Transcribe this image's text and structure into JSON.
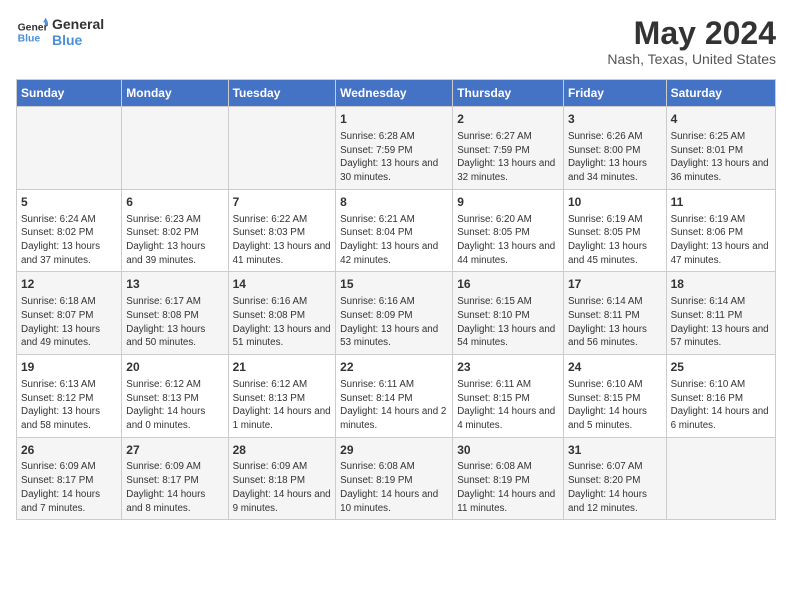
{
  "header": {
    "logo_line1": "General",
    "logo_line2": "Blue",
    "month_year": "May 2024",
    "location": "Nash, Texas, United States"
  },
  "days_of_week": [
    "Sunday",
    "Monday",
    "Tuesday",
    "Wednesday",
    "Thursday",
    "Friday",
    "Saturday"
  ],
  "weeks": [
    [
      {
        "day": "",
        "info": ""
      },
      {
        "day": "",
        "info": ""
      },
      {
        "day": "",
        "info": ""
      },
      {
        "day": "1",
        "info": "Sunrise: 6:28 AM\nSunset: 7:59 PM\nDaylight: 13 hours and 30 minutes."
      },
      {
        "day": "2",
        "info": "Sunrise: 6:27 AM\nSunset: 7:59 PM\nDaylight: 13 hours and 32 minutes."
      },
      {
        "day": "3",
        "info": "Sunrise: 6:26 AM\nSunset: 8:00 PM\nDaylight: 13 hours and 34 minutes."
      },
      {
        "day": "4",
        "info": "Sunrise: 6:25 AM\nSunset: 8:01 PM\nDaylight: 13 hours and 36 minutes."
      }
    ],
    [
      {
        "day": "5",
        "info": "Sunrise: 6:24 AM\nSunset: 8:02 PM\nDaylight: 13 hours and 37 minutes."
      },
      {
        "day": "6",
        "info": "Sunrise: 6:23 AM\nSunset: 8:02 PM\nDaylight: 13 hours and 39 minutes."
      },
      {
        "day": "7",
        "info": "Sunrise: 6:22 AM\nSunset: 8:03 PM\nDaylight: 13 hours and 41 minutes."
      },
      {
        "day": "8",
        "info": "Sunrise: 6:21 AM\nSunset: 8:04 PM\nDaylight: 13 hours and 42 minutes."
      },
      {
        "day": "9",
        "info": "Sunrise: 6:20 AM\nSunset: 8:05 PM\nDaylight: 13 hours and 44 minutes."
      },
      {
        "day": "10",
        "info": "Sunrise: 6:19 AM\nSunset: 8:05 PM\nDaylight: 13 hours and 45 minutes."
      },
      {
        "day": "11",
        "info": "Sunrise: 6:19 AM\nSunset: 8:06 PM\nDaylight: 13 hours and 47 minutes."
      }
    ],
    [
      {
        "day": "12",
        "info": "Sunrise: 6:18 AM\nSunset: 8:07 PM\nDaylight: 13 hours and 49 minutes."
      },
      {
        "day": "13",
        "info": "Sunrise: 6:17 AM\nSunset: 8:08 PM\nDaylight: 13 hours and 50 minutes."
      },
      {
        "day": "14",
        "info": "Sunrise: 6:16 AM\nSunset: 8:08 PM\nDaylight: 13 hours and 51 minutes."
      },
      {
        "day": "15",
        "info": "Sunrise: 6:16 AM\nSunset: 8:09 PM\nDaylight: 13 hours and 53 minutes."
      },
      {
        "day": "16",
        "info": "Sunrise: 6:15 AM\nSunset: 8:10 PM\nDaylight: 13 hours and 54 minutes."
      },
      {
        "day": "17",
        "info": "Sunrise: 6:14 AM\nSunset: 8:11 PM\nDaylight: 13 hours and 56 minutes."
      },
      {
        "day": "18",
        "info": "Sunrise: 6:14 AM\nSunset: 8:11 PM\nDaylight: 13 hours and 57 minutes."
      }
    ],
    [
      {
        "day": "19",
        "info": "Sunrise: 6:13 AM\nSunset: 8:12 PM\nDaylight: 13 hours and 58 minutes."
      },
      {
        "day": "20",
        "info": "Sunrise: 6:12 AM\nSunset: 8:13 PM\nDaylight: 14 hours and 0 minutes."
      },
      {
        "day": "21",
        "info": "Sunrise: 6:12 AM\nSunset: 8:13 PM\nDaylight: 14 hours and 1 minute."
      },
      {
        "day": "22",
        "info": "Sunrise: 6:11 AM\nSunset: 8:14 PM\nDaylight: 14 hours and 2 minutes."
      },
      {
        "day": "23",
        "info": "Sunrise: 6:11 AM\nSunset: 8:15 PM\nDaylight: 14 hours and 4 minutes."
      },
      {
        "day": "24",
        "info": "Sunrise: 6:10 AM\nSunset: 8:15 PM\nDaylight: 14 hours and 5 minutes."
      },
      {
        "day": "25",
        "info": "Sunrise: 6:10 AM\nSunset: 8:16 PM\nDaylight: 14 hours and 6 minutes."
      }
    ],
    [
      {
        "day": "26",
        "info": "Sunrise: 6:09 AM\nSunset: 8:17 PM\nDaylight: 14 hours and 7 minutes."
      },
      {
        "day": "27",
        "info": "Sunrise: 6:09 AM\nSunset: 8:17 PM\nDaylight: 14 hours and 8 minutes."
      },
      {
        "day": "28",
        "info": "Sunrise: 6:09 AM\nSunset: 8:18 PM\nDaylight: 14 hours and 9 minutes."
      },
      {
        "day": "29",
        "info": "Sunrise: 6:08 AM\nSunset: 8:19 PM\nDaylight: 14 hours and 10 minutes."
      },
      {
        "day": "30",
        "info": "Sunrise: 6:08 AM\nSunset: 8:19 PM\nDaylight: 14 hours and 11 minutes."
      },
      {
        "day": "31",
        "info": "Sunrise: 6:07 AM\nSunset: 8:20 PM\nDaylight: 14 hours and 12 minutes."
      },
      {
        "day": "",
        "info": ""
      }
    ]
  ]
}
